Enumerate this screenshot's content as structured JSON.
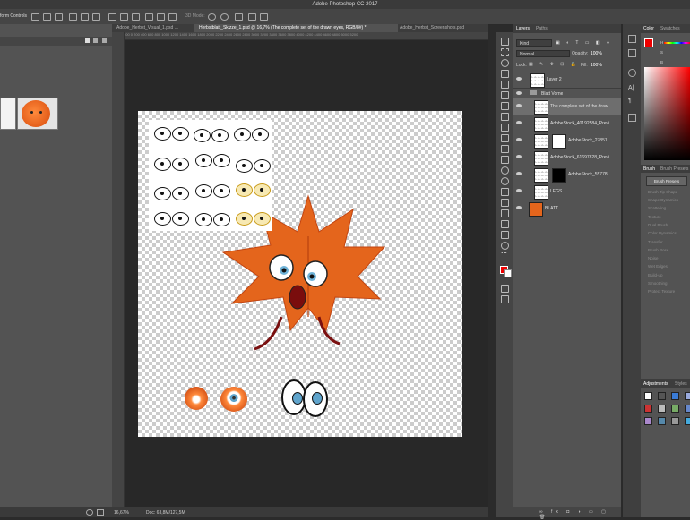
{
  "app": {
    "title": "Adobe Photoshop CC 2017"
  },
  "options_bar": {
    "label": "form Controls",
    "mode_3d": "3D Mode:"
  },
  "doc_tabs": [
    {
      "label": "Adobe_Herbst_Visual_1.psd ..."
    },
    {
      "label": "Herbstblatt_Skizze_1.psd @ 16,7% (The complete set of the drawn eyes, RGB/8#) *"
    },
    {
      "label": "Adobe_Herbst_Screenshots.psd"
    }
  ],
  "ruler": {
    "ticks": "200 0 200 400 600 800 1000 1200 1400 1600 1800 2000 2200 2400 2600 2800 3000 3200 3400 3600 3800 4000 4200 4400 4600 4800 5000 5200"
  },
  "status": {
    "zoom": "16,67%",
    "doc": "Doc: 63,8M/127,5M"
  },
  "layers_panel": {
    "tabs": [
      {
        "label": "Layers"
      },
      {
        "label": "Paths"
      }
    ],
    "filter": "Kind",
    "blend_mode": "Normal",
    "opacity_label": "Opacity:",
    "opacity": "100%",
    "lock_label": "Lock:",
    "fill_label": "Fill:",
    "fill": "100%",
    "layers": [
      {
        "name": "Layer 2"
      },
      {
        "name": "Blatt Vorne"
      },
      {
        "name": "The complete set of the draw..."
      },
      {
        "name": "AdobeStock_40192584_Previ..."
      },
      {
        "name": "AdobeStock_27851..."
      },
      {
        "name": "AdobeStock_61697828_Previ..."
      },
      {
        "name": "AdobeStock_55778..."
      },
      {
        "name": "LEGS"
      },
      {
        "name": "BLATT"
      }
    ]
  },
  "color_panel": {
    "tabs": [
      {
        "label": "Color"
      },
      {
        "label": "Swatches"
      }
    ],
    "h": "H",
    "s": "S",
    "b": "B"
  },
  "brush_panel": {
    "tabs": [
      {
        "label": "Brush"
      },
      {
        "label": "Brush Presets"
      }
    ],
    "presets_button": "Brush Presets",
    "items": [
      "Brush Tip Shape",
      "Shape Dynamics",
      "Scattering",
      "Texture",
      "Dual Brush",
      "Color Dynamics",
      "Transfer",
      "Brush Pose",
      "Noise",
      "Wet Edges",
      "Build-up",
      "Smoothing",
      "Protect Texture"
    ]
  },
  "adjustments_panel": {
    "tabs": [
      {
        "label": "Adjustments"
      },
      {
        "label": "Styles"
      }
    ]
  },
  "colors": {
    "foreground": "#e00000",
    "background": "#ffffff",
    "selected_layer": "#6e6e6e",
    "leaf": "#e4651c"
  }
}
